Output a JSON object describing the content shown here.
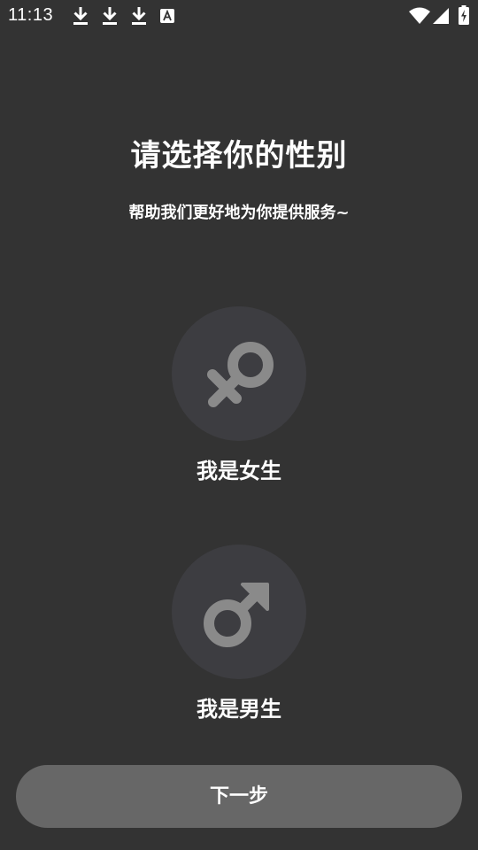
{
  "status_bar": {
    "time": "11:13",
    "notification_icons": [
      "download-icon",
      "download-icon",
      "download-icon",
      "font-app-icon"
    ],
    "system_icons": [
      "wifi-icon",
      "cellular-signal-icon",
      "battery-charging-icon"
    ]
  },
  "title": "请选择你的性别",
  "subtitle": "帮助我们更好地为你提供服务~",
  "options": [
    {
      "icon": "female-symbol-icon",
      "label": "我是女生"
    },
    {
      "icon": "male-symbol-icon",
      "label": "我是男生"
    }
  ],
  "next_button": {
    "label": "下一步"
  },
  "colors": {
    "background": "#333333",
    "circle": "#3d3d41",
    "icon": "#8a8a8a",
    "button": "#676767",
    "text": "#ffffff"
  }
}
